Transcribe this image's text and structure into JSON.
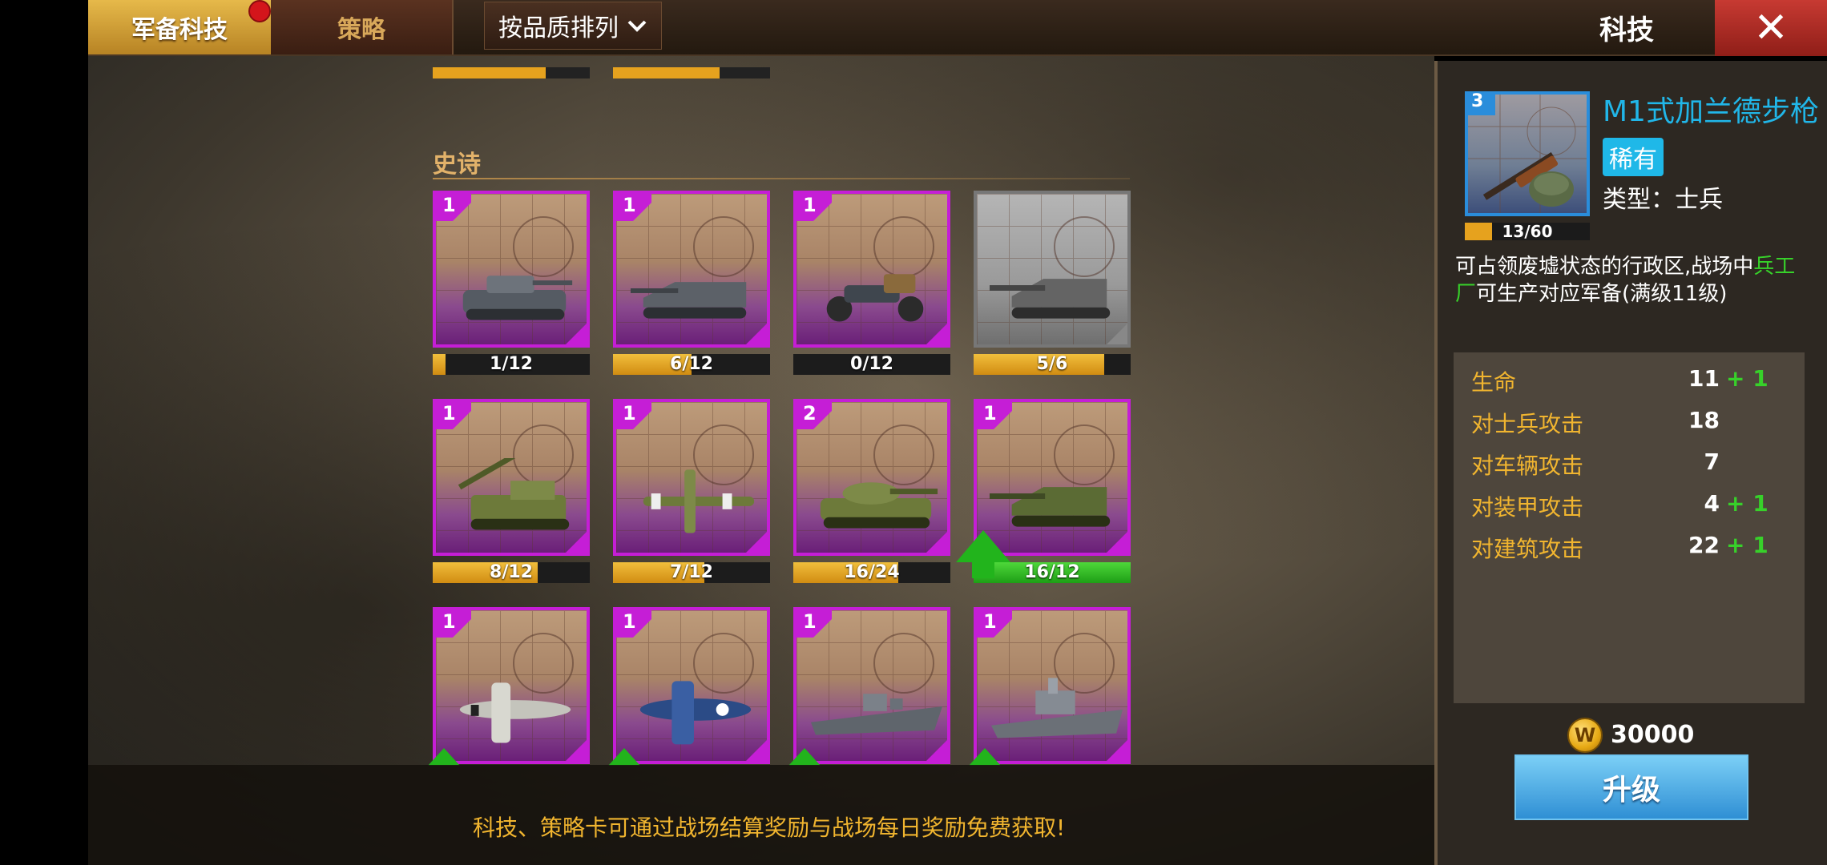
{
  "tabs": [
    {
      "label": "军备科技",
      "active": true
    },
    {
      "label": "策略",
      "active": false
    }
  ],
  "sort": {
    "label": "按品质排列",
    "icon": "chevron-down-icon"
  },
  "panel_title": "科技",
  "close_icon": "close-icon",
  "section": {
    "title": "史诗"
  },
  "cards": [
    {
      "level": "1",
      "progress": "1/12",
      "fill": 0.08,
      "unit": "tank-icon",
      "locked": false,
      "upgradable": false
    },
    {
      "level": "1",
      "progress": "6/12",
      "fill": 0.5,
      "unit": "assault-gun-icon",
      "locked": false,
      "upgradable": false
    },
    {
      "level": "1",
      "progress": "0/12",
      "fill": 0.0,
      "unit": "motorcycle-icon",
      "locked": false,
      "upgradable": false
    },
    {
      "level": "",
      "progress": "5/6",
      "fill": 0.83,
      "unit": "tank-destroyer-icon",
      "locked": true,
      "upgradable": false
    },
    {
      "level": "1",
      "progress": "8/12",
      "fill": 0.67,
      "unit": "artillery-icon",
      "locked": false,
      "upgradable": false
    },
    {
      "level": "1",
      "progress": "7/12",
      "fill": 0.58,
      "unit": "bomber-icon",
      "locked": false,
      "upgradable": false
    },
    {
      "level": "2",
      "progress": "16/24",
      "fill": 0.67,
      "unit": "heavy-tank-icon",
      "locked": false,
      "upgradable": false
    },
    {
      "level": "1",
      "progress": "16/12",
      "fill": 1.0,
      "unit": "tank-destroyer-icon",
      "locked": false,
      "upgradable": true
    },
    {
      "level": "1",
      "progress": "",
      "fill": 0.0,
      "unit": "fighter-plane-icon",
      "locked": false,
      "upgradable": true
    },
    {
      "level": "1",
      "progress": "",
      "fill": 0.0,
      "unit": "dive-bomber-icon",
      "locked": false,
      "upgradable": true
    },
    {
      "level": "1",
      "progress": "",
      "fill": 0.0,
      "unit": "destroyer-ship-icon",
      "locked": false,
      "upgradable": true
    },
    {
      "level": "1",
      "progress": "",
      "fill": 0.0,
      "unit": "battleship-icon",
      "locked": false,
      "upgradable": true
    }
  ],
  "hint": "科技、策略卡可通过战场结算奖励与战场每日奖励免费获取!",
  "detail": {
    "level": "3",
    "progress": "13/60",
    "fill": 0.22,
    "name": "M1式加兰德步枪",
    "rarity": "稀有",
    "type": "类型：士兵",
    "desc_pre": "可占领废墟状态的行政区,战场中",
    "desc_hl": "兵工厂",
    "desc_post": "可生产对应军备(满级11级)",
    "stats": [
      {
        "label": "生命",
        "value": "11",
        "bonus": "+ 1"
      },
      {
        "label": "对士兵攻击",
        "value": "18",
        "bonus": ""
      },
      {
        "label": "对车辆攻击",
        "value": "7",
        "bonus": ""
      },
      {
        "label": "对装甲攻击",
        "value": "4",
        "bonus": "+ 1"
      },
      {
        "label": "对建筑攻击",
        "value": "22",
        "bonus": "+ 1"
      }
    ],
    "cost": "30000",
    "coin_symbol": "W",
    "upgrade_label": "升级"
  },
  "colors": {
    "epic": "#c51ed6",
    "rare": "#1fb8e8",
    "accent": "#f1b52f",
    "bonus": "#37d12a"
  }
}
